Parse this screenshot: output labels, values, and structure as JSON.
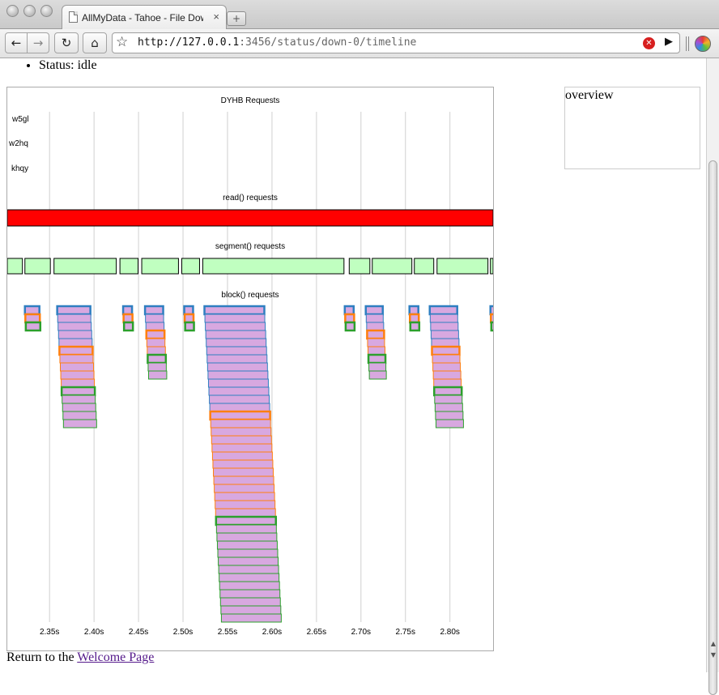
{
  "browser": {
    "tab_title": "AllMyData - Tahoe - File Dow",
    "tab_close": "×",
    "new_tab_glyph": "+",
    "url_host": "http://127.0.0.1",
    "url_path": ":3456/status/down-0/timeline",
    "buttons": {
      "back": "←",
      "forward": "→",
      "reload": "↻",
      "home": "⌂",
      "bookmark": "☆",
      "go": "▶",
      "stop": "✕"
    }
  },
  "page": {
    "status_text": "Status: idle",
    "overview_label": "overview",
    "footer_text": "Return to the ",
    "footer_link": "Welcome Page"
  },
  "colors": {
    "read_bar": "#ff0000",
    "segment_fill": "#c0ffc0",
    "block_fill": "#d8a8e0",
    "server_w5gl": "#2f7fc1",
    "server_w2hq": "#ff7f0e",
    "server_khqy": "#2ca02c",
    "grid": "#d0d0d0"
  },
  "chart_data": {
    "type": "timeline",
    "sections": [
      "DYHB Requests",
      "read() requests",
      "segment() requests",
      "block() requests"
    ],
    "servers": [
      "w5gl",
      "w2hq",
      "khqy"
    ],
    "xlim": [
      2.3025,
      2.8485
    ],
    "xticks": [
      2.35,
      2.4,
      2.45,
      2.5,
      2.55,
      2.6,
      2.65,
      2.7,
      2.75,
      2.8
    ],
    "xtick_labels": [
      "2.35s",
      "2.40s",
      "2.45s",
      "2.50s",
      "2.55s",
      "2.60s",
      "2.65s",
      "2.70s",
      "2.75s",
      "2.80s"
    ],
    "read_requests": [
      [
        2.3025,
        2.8485
      ]
    ],
    "segment_requests": [
      [
        2.3025,
        2.3195
      ],
      [
        2.3223,
        2.3509
      ],
      [
        2.355,
        2.425
      ],
      [
        2.4291,
        2.4495
      ],
      [
        2.4536,
        2.4949
      ],
      [
        2.4986,
        2.5186
      ],
      [
        2.5222,
        2.6809
      ],
      [
        2.6868,
        2.71
      ],
      [
        2.7127,
        2.7572
      ],
      [
        2.76,
        2.7818
      ],
      [
        2.7855,
        2.8427
      ],
      [
        2.8455,
        2.8485
      ]
    ],
    "block_groups": [
      {
        "start": 2.3223,
        "end": 2.3386,
        "first_server": "w5gl",
        "runs": [
          [
            "w5gl",
            1
          ],
          [
            "w2hq",
            1
          ],
          [
            "khqy",
            1
          ]
        ]
      },
      {
        "start": 2.3586,
        "end": 2.3959,
        "first_server": "w5gl",
        "runs": [
          [
            "w5gl",
            5
          ],
          [
            "w2hq",
            5
          ],
          [
            "khqy",
            5
          ]
        ]
      },
      {
        "start": 2.4327,
        "end": 2.4427,
        "first_server": "w5gl",
        "runs": [
          [
            "w5gl",
            1
          ],
          [
            "w2hq",
            1
          ],
          [
            "khqy",
            1
          ]
        ]
      },
      {
        "start": 2.4573,
        "end": 2.4777,
        "first_server": "w5gl",
        "runs": [
          [
            "w5gl",
            3
          ],
          [
            "w2hq",
            3
          ],
          [
            "khqy",
            3
          ]
        ]
      },
      {
        "start": 2.5014,
        "end": 2.5113,
        "first_server": "w5gl",
        "runs": [
          [
            "w5gl",
            1
          ],
          [
            "w2hq",
            1
          ],
          [
            "khqy",
            1
          ]
        ]
      },
      {
        "start": 2.5241,
        "end": 2.5914,
        "first_server": "w5gl",
        "runs": [
          [
            "w5gl",
            13
          ],
          [
            "w2hq",
            13
          ],
          [
            "khqy",
            13
          ]
        ]
      },
      {
        "start": 2.6818,
        "end": 2.6918,
        "first_server": "w5gl",
        "runs": [
          [
            "w5gl",
            1
          ],
          [
            "w2hq",
            1
          ],
          [
            "khqy",
            1
          ]
        ]
      },
      {
        "start": 2.7054,
        "end": 2.7245,
        "first_server": "w5gl",
        "runs": [
          [
            "w5gl",
            3
          ],
          [
            "w2hq",
            3
          ],
          [
            "khqy",
            3
          ]
        ]
      },
      {
        "start": 2.7545,
        "end": 2.7645,
        "first_server": "w5gl",
        "runs": [
          [
            "w5gl",
            1
          ],
          [
            "w2hq",
            1
          ],
          [
            "khqy",
            1
          ]
        ]
      },
      {
        "start": 2.7773,
        "end": 2.8082,
        "first_server": "w5gl",
        "runs": [
          [
            "w5gl",
            5
          ],
          [
            "w2hq",
            5
          ],
          [
            "khqy",
            5
          ]
        ]
      },
      {
        "start": 2.8455,
        "end": 2.8555,
        "first_server": "w5gl",
        "runs": [
          [
            "w5gl",
            1
          ],
          [
            "w2hq",
            1
          ],
          [
            "khqy",
            1
          ]
        ]
      }
    ]
  }
}
